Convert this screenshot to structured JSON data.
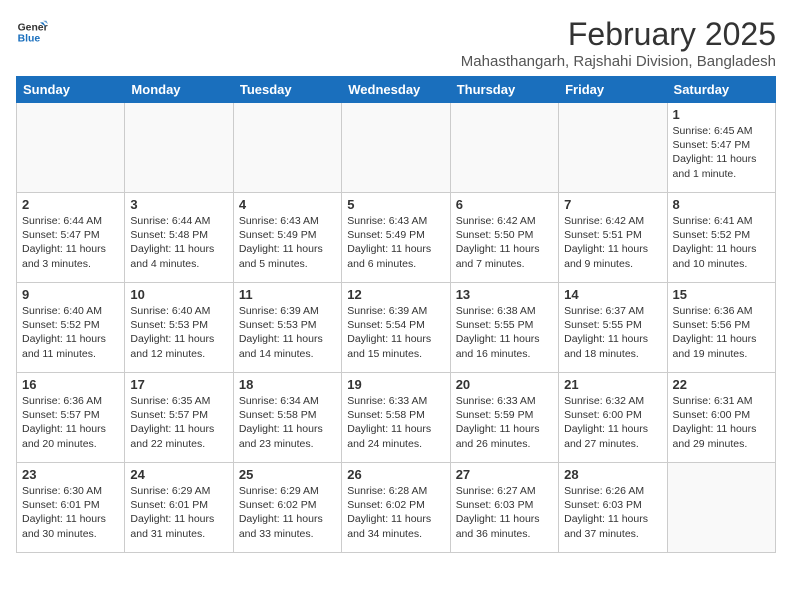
{
  "logo": {
    "line1": "General",
    "line2": "Blue"
  },
  "title": "February 2025",
  "subtitle": "Mahasthangarh, Rajshahi Division, Bangladesh",
  "days_of_week": [
    "Sunday",
    "Monday",
    "Tuesday",
    "Wednesday",
    "Thursday",
    "Friday",
    "Saturday"
  ],
  "weeks": [
    [
      {
        "day": "",
        "info": ""
      },
      {
        "day": "",
        "info": ""
      },
      {
        "day": "",
        "info": ""
      },
      {
        "day": "",
        "info": ""
      },
      {
        "day": "",
        "info": ""
      },
      {
        "day": "",
        "info": ""
      },
      {
        "day": "1",
        "info": "Sunrise: 6:45 AM\nSunset: 5:47 PM\nDaylight: 11 hours\nand 1 minute."
      }
    ],
    [
      {
        "day": "2",
        "info": "Sunrise: 6:44 AM\nSunset: 5:47 PM\nDaylight: 11 hours\nand 3 minutes."
      },
      {
        "day": "3",
        "info": "Sunrise: 6:44 AM\nSunset: 5:48 PM\nDaylight: 11 hours\nand 4 minutes."
      },
      {
        "day": "4",
        "info": "Sunrise: 6:43 AM\nSunset: 5:49 PM\nDaylight: 11 hours\nand 5 minutes."
      },
      {
        "day": "5",
        "info": "Sunrise: 6:43 AM\nSunset: 5:49 PM\nDaylight: 11 hours\nand 6 minutes."
      },
      {
        "day": "6",
        "info": "Sunrise: 6:42 AM\nSunset: 5:50 PM\nDaylight: 11 hours\nand 7 minutes."
      },
      {
        "day": "7",
        "info": "Sunrise: 6:42 AM\nSunset: 5:51 PM\nDaylight: 11 hours\nand 9 minutes."
      },
      {
        "day": "8",
        "info": "Sunrise: 6:41 AM\nSunset: 5:52 PM\nDaylight: 11 hours\nand 10 minutes."
      }
    ],
    [
      {
        "day": "9",
        "info": "Sunrise: 6:40 AM\nSunset: 5:52 PM\nDaylight: 11 hours\nand 11 minutes."
      },
      {
        "day": "10",
        "info": "Sunrise: 6:40 AM\nSunset: 5:53 PM\nDaylight: 11 hours\nand 12 minutes."
      },
      {
        "day": "11",
        "info": "Sunrise: 6:39 AM\nSunset: 5:53 PM\nDaylight: 11 hours\nand 14 minutes."
      },
      {
        "day": "12",
        "info": "Sunrise: 6:39 AM\nSunset: 5:54 PM\nDaylight: 11 hours\nand 15 minutes."
      },
      {
        "day": "13",
        "info": "Sunrise: 6:38 AM\nSunset: 5:55 PM\nDaylight: 11 hours\nand 16 minutes."
      },
      {
        "day": "14",
        "info": "Sunrise: 6:37 AM\nSunset: 5:55 PM\nDaylight: 11 hours\nand 18 minutes."
      },
      {
        "day": "15",
        "info": "Sunrise: 6:36 AM\nSunset: 5:56 PM\nDaylight: 11 hours\nand 19 minutes."
      }
    ],
    [
      {
        "day": "16",
        "info": "Sunrise: 6:36 AM\nSunset: 5:57 PM\nDaylight: 11 hours\nand 20 minutes."
      },
      {
        "day": "17",
        "info": "Sunrise: 6:35 AM\nSunset: 5:57 PM\nDaylight: 11 hours\nand 22 minutes."
      },
      {
        "day": "18",
        "info": "Sunrise: 6:34 AM\nSunset: 5:58 PM\nDaylight: 11 hours\nand 23 minutes."
      },
      {
        "day": "19",
        "info": "Sunrise: 6:33 AM\nSunset: 5:58 PM\nDaylight: 11 hours\nand 24 minutes."
      },
      {
        "day": "20",
        "info": "Sunrise: 6:33 AM\nSunset: 5:59 PM\nDaylight: 11 hours\nand 26 minutes."
      },
      {
        "day": "21",
        "info": "Sunrise: 6:32 AM\nSunset: 6:00 PM\nDaylight: 11 hours\nand 27 minutes."
      },
      {
        "day": "22",
        "info": "Sunrise: 6:31 AM\nSunset: 6:00 PM\nDaylight: 11 hours\nand 29 minutes."
      }
    ],
    [
      {
        "day": "23",
        "info": "Sunrise: 6:30 AM\nSunset: 6:01 PM\nDaylight: 11 hours\nand 30 minutes."
      },
      {
        "day": "24",
        "info": "Sunrise: 6:29 AM\nSunset: 6:01 PM\nDaylight: 11 hours\nand 31 minutes."
      },
      {
        "day": "25",
        "info": "Sunrise: 6:29 AM\nSunset: 6:02 PM\nDaylight: 11 hours\nand 33 minutes."
      },
      {
        "day": "26",
        "info": "Sunrise: 6:28 AM\nSunset: 6:02 PM\nDaylight: 11 hours\nand 34 minutes."
      },
      {
        "day": "27",
        "info": "Sunrise: 6:27 AM\nSunset: 6:03 PM\nDaylight: 11 hours\nand 36 minutes."
      },
      {
        "day": "28",
        "info": "Sunrise: 6:26 AM\nSunset: 6:03 PM\nDaylight: 11 hours\nand 37 minutes."
      },
      {
        "day": "",
        "info": ""
      }
    ]
  ]
}
